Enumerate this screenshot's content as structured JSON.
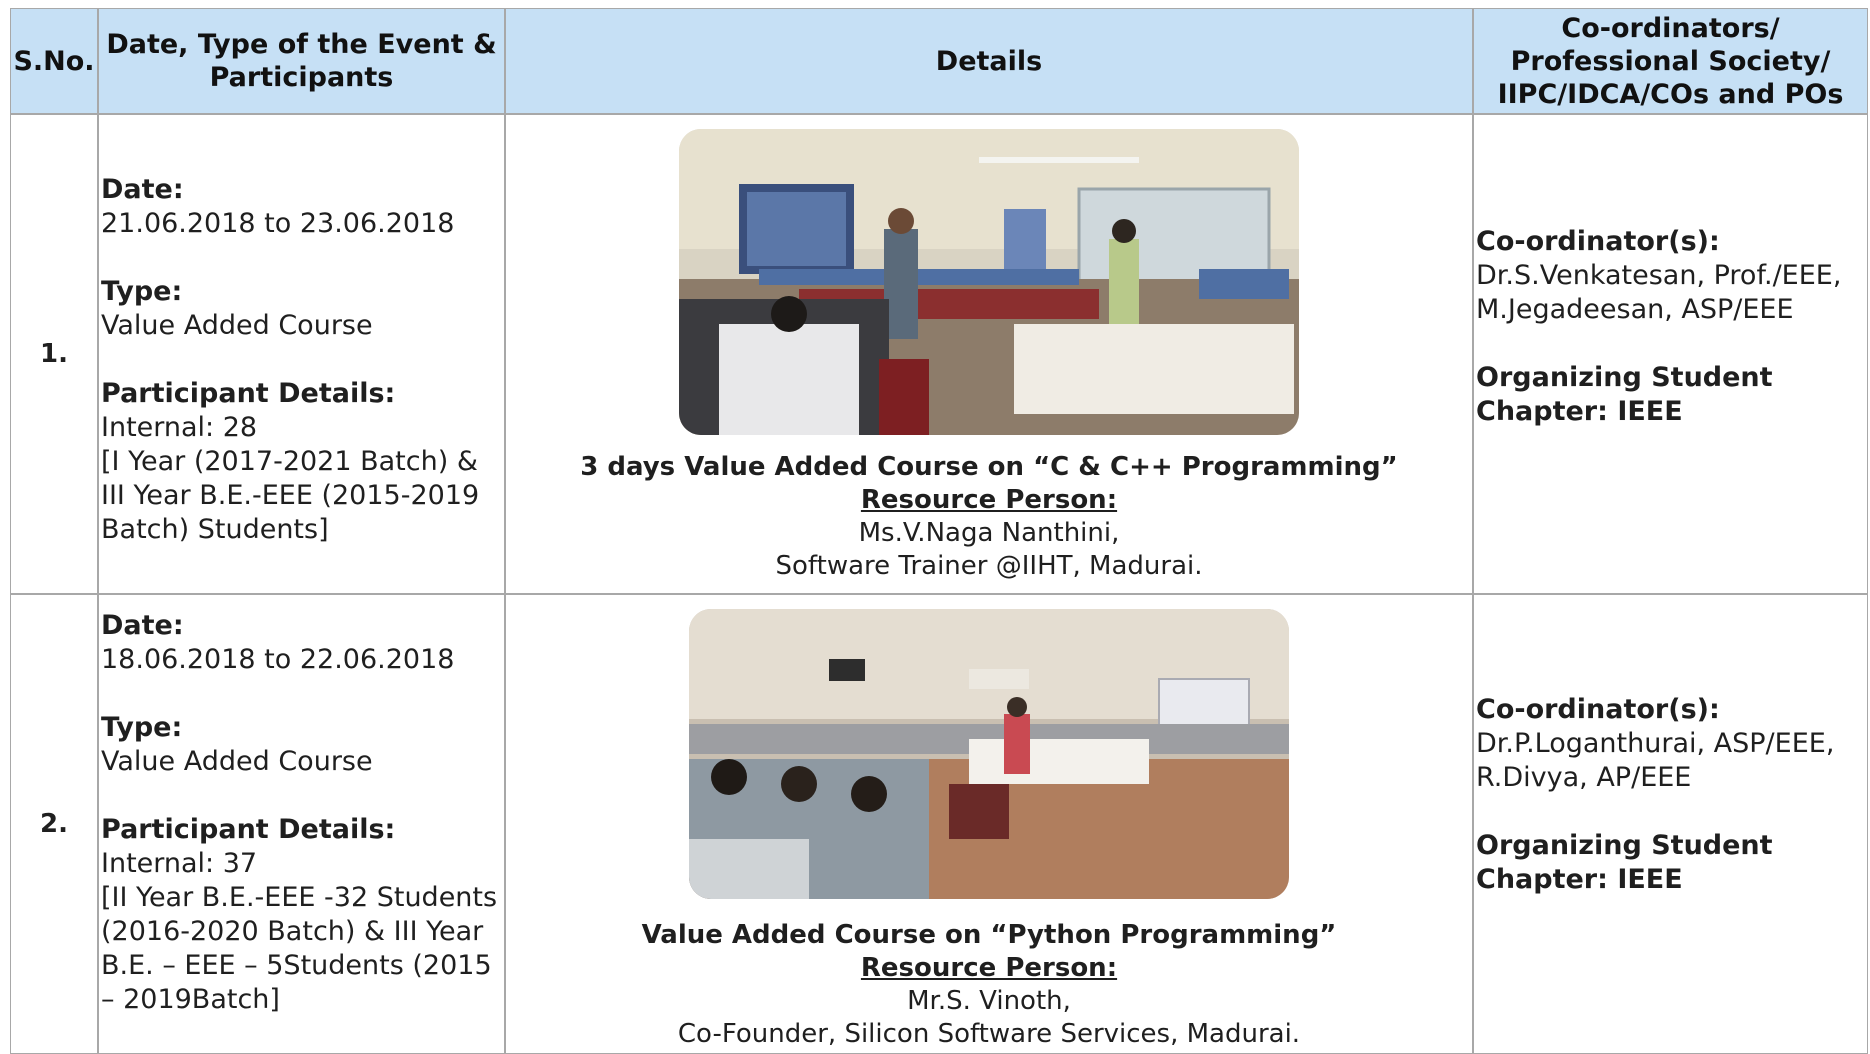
{
  "header": {
    "sno": "S.No.",
    "date_type": "Date, Type of the Event & Participants",
    "details": "Details",
    "coordinators": "Co-ordinators/ Professional Society/ IIPC/IDCA/COs and POs"
  },
  "rows": [
    {
      "sno": "1.",
      "date_label": "Date:",
      "date": "21.06.2018 to 23.06.2018",
      "type_label": "Type:",
      "type": "Value Added Course",
      "participant_label": "Participant Details:",
      "internal": "Internal: 28",
      "participant_desc": "[I Year (2017-2021 Batch) & III Year B.E.-EEE  (2015-2019 Batch) Students]",
      "title": "3 days Value Added Course on “C & C++ Programming”",
      "resource_label": "Resource Person:",
      "person": "Ms.V.Naga Nanthini,",
      "affiliation": "Software Trainer @IIHT, Madurai.",
      "coordinator_label": "Co-ordinator(s):",
      "coordinator_1": "Dr.S.Venkatesan, Prof./EEE,",
      "coordinator_2": "M.Jegadeesan, ASP/EEE",
      "chapter": "Organizing Student Chapter: IEEE"
    },
    {
      "sno": "2.",
      "date_label": "Date:",
      "date": "18.06.2018 to 22.06.2018",
      "type_label": "Type:",
      "type": "Value Added Course",
      "participant_label": "Participant Details:",
      "internal": "Internal: 37",
      "participant_desc": "[II Year B.E.-EEE -32 Students (2016-2020 Batch) & III Year B.E. – EEE – 5Students (2015 – 2019Batch]",
      "title": "Value Added Course on “Python Programming”",
      "resource_label": "Resource Person:",
      "person": "Mr.S. Vinoth,",
      "affiliation": "Co-Founder, Silicon Software Services, Madurai.",
      "coordinator_label": "Co-ordinator(s):",
      "coordinator_1": "Dr.P.Loganthurai, ASP/EEE,",
      "coordinator_2": "R.Divya, AP/EEE",
      "chapter": "Organizing Student Chapter: IEEE"
    }
  ]
}
